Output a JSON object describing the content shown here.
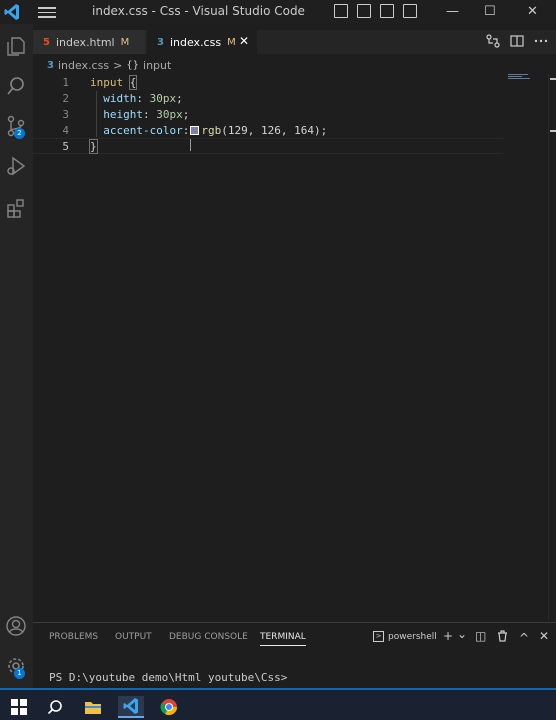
{
  "window": {
    "title": "index.css - Css - Visual Studio Code",
    "controls": {
      "minimize": "—",
      "maximize": "☐",
      "close": "✕"
    }
  },
  "activity_bar": {
    "items": [
      "explorer-icon",
      "search-icon",
      "source-control-icon",
      "run-debug-icon",
      "extensions-icon"
    ],
    "source_control_badge": "2",
    "bottom_items": [
      "account-icon",
      "settings-gear-icon"
    ],
    "settings_badge": "1"
  },
  "tabs": [
    {
      "label": "index.html",
      "status": "M",
      "icon_text": "5",
      "icon_color": "#e44d26",
      "active": false
    },
    {
      "label": "index.css",
      "status": "M",
      "icon_text": "3",
      "icon_color": "#519aba",
      "active": true,
      "close": "✕"
    }
  ],
  "breadcrumb": {
    "file_icon": "3",
    "file": "index.css",
    "separator": ">",
    "symbol_icon": "{}",
    "symbol": "input"
  },
  "editor": {
    "line_numbers": [
      "1",
      "2",
      "3",
      "4",
      "5"
    ],
    "lines": {
      "l1_selector": "input",
      "l1_brace": "{",
      "l2_prop": "width",
      "l2_colon": ": ",
      "l2_value": "30px",
      "l2_semi": ";",
      "l3_prop": "height",
      "l3_colon": ": ",
      "l3_value": "30px",
      "l3_semi": ";",
      "l4_prop": "accent-color",
      "l4_colon": ":",
      "l4_fn": "rgb",
      "l4_args": "(129, 126, 164)",
      "l4_semi": ";",
      "l5_brace": "}"
    },
    "swatch_color": "#817ea4"
  },
  "panel": {
    "tabs": [
      "PROBLEMS",
      "OUTPUT",
      "DEBUG CONSOLE",
      "TERMINAL"
    ],
    "active_tab": "TERMINAL",
    "shell": "powershell",
    "actions": {
      "add": "+",
      "dropdown": "⌄",
      "split": "◫",
      "trash": "🗑",
      "maximize": "^",
      "close": "✕"
    },
    "terminal_prompt": "PS D:\\youtube demo\\Html youtube\\Css>"
  },
  "taskbar": {
    "items": [
      "windows-start-icon",
      "search-icon",
      "file-explorer-icon",
      "vscode-icon",
      "chrome-icon"
    ]
  },
  "colors": {
    "editor_bg": "#1e1e1e",
    "accent": "#0078d4",
    "modified": "#e2c08d"
  }
}
